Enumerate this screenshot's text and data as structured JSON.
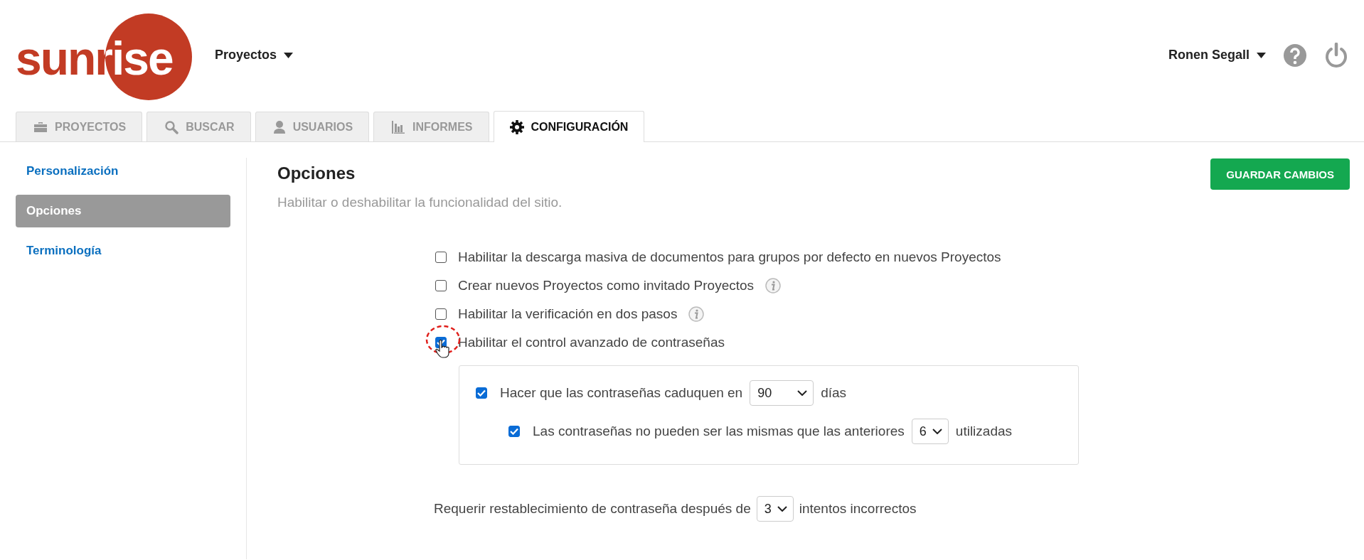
{
  "logo": {
    "text": "sunrise"
  },
  "project_menu": {
    "label": "Proyectos"
  },
  "user_menu": {
    "label": "Ronen Segall"
  },
  "tabs": [
    {
      "label": "PROYECTOS",
      "selected": false
    },
    {
      "label": "BUSCAR",
      "selected": false
    },
    {
      "label": "USUARIOS",
      "selected": false
    },
    {
      "label": "INFORMES",
      "selected": false
    },
    {
      "label": "CONFIGURACIÓN",
      "selected": true
    }
  ],
  "sidebar": {
    "items": [
      {
        "label": "Personalización",
        "selected": false
      },
      {
        "label": "Opciones",
        "selected": true
      },
      {
        "label": "Terminología",
        "selected": false
      }
    ]
  },
  "page": {
    "title": "Opciones",
    "subtitle": "Habilitar o deshabilitar la funcionalidad del sitio.",
    "save_button": "GUARDAR CAMBIOS"
  },
  "options": [
    {
      "label": "Habilitar la descarga masiva de documentos para grupos por defecto en nuevos Proyectos",
      "checked": false,
      "info": false,
      "highlighted": false
    },
    {
      "label": "Crear nuevos Proyectos como invitado Proyectos",
      "checked": false,
      "info": true,
      "highlighted": false
    },
    {
      "label": "Habilitar la verificación en dos pasos",
      "checked": false,
      "info": true,
      "highlighted": false
    },
    {
      "label": "Habilitar el control avanzado de contraseñas",
      "checked": true,
      "info": false,
      "highlighted": true
    }
  ],
  "password_panel": {
    "expiry": {
      "checked": true,
      "before": "Hacer que las contraseñas caduquen en",
      "value": "90",
      "after": "días"
    },
    "history": {
      "checked": true,
      "before": "Las contraseñas no pueden ser las mismas que las anteriores",
      "value": "6",
      "after": "utilizadas"
    }
  },
  "lockout": {
    "before": "Requerir restablecimiento de contraseña después de",
    "value": "3",
    "after": "intentos incorrectos"
  }
}
